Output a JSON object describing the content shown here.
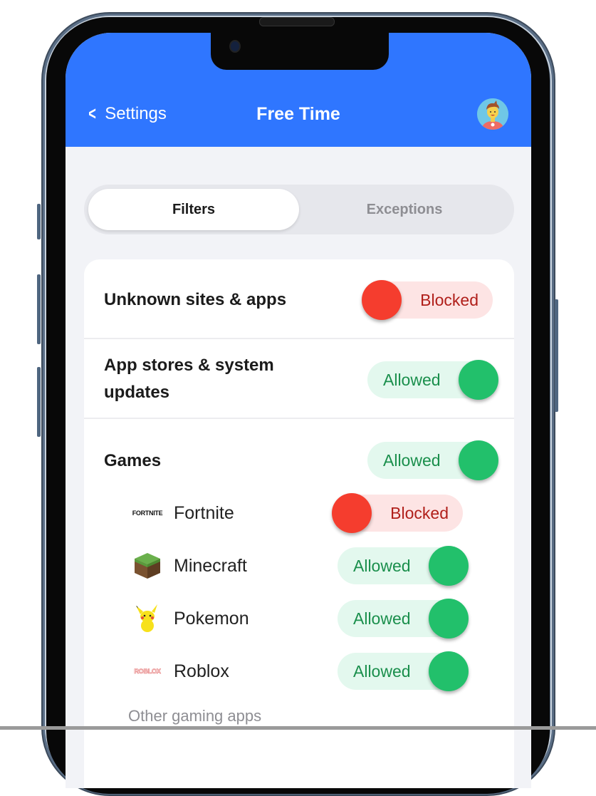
{
  "header": {
    "back_label": "Settings",
    "title": "Free Time",
    "avatar": "child-avatar"
  },
  "tabs": [
    {
      "label": "Filters",
      "active": true
    },
    {
      "label": "Exceptions",
      "active": false
    }
  ],
  "filters": [
    {
      "label": "Unknown sites & apps",
      "state": "Blocked"
    },
    {
      "label_line1": "App stores & system",
      "label_line2": "updates",
      "state": "Allowed"
    },
    {
      "label": "Games",
      "state": "Allowed"
    }
  ],
  "games": [
    {
      "name": "Fortnite",
      "icon": "fortnite-logo",
      "icon_text": "FORTNITE",
      "state": "Blocked"
    },
    {
      "name": "Minecraft",
      "icon": "minecraft-grass-block",
      "state": "Allowed"
    },
    {
      "name": "Pokemon",
      "icon": "pikachu",
      "state": "Allowed"
    },
    {
      "name": "Roblox",
      "icon": "roblox-logo",
      "icon_text": "ROBLOX",
      "state": "Allowed"
    }
  ],
  "other_label": "Other gaming apps",
  "colors": {
    "header_blue": "#2f76ff",
    "blocked_red": "#f53d2e",
    "allowed_green": "#22c06b"
  }
}
